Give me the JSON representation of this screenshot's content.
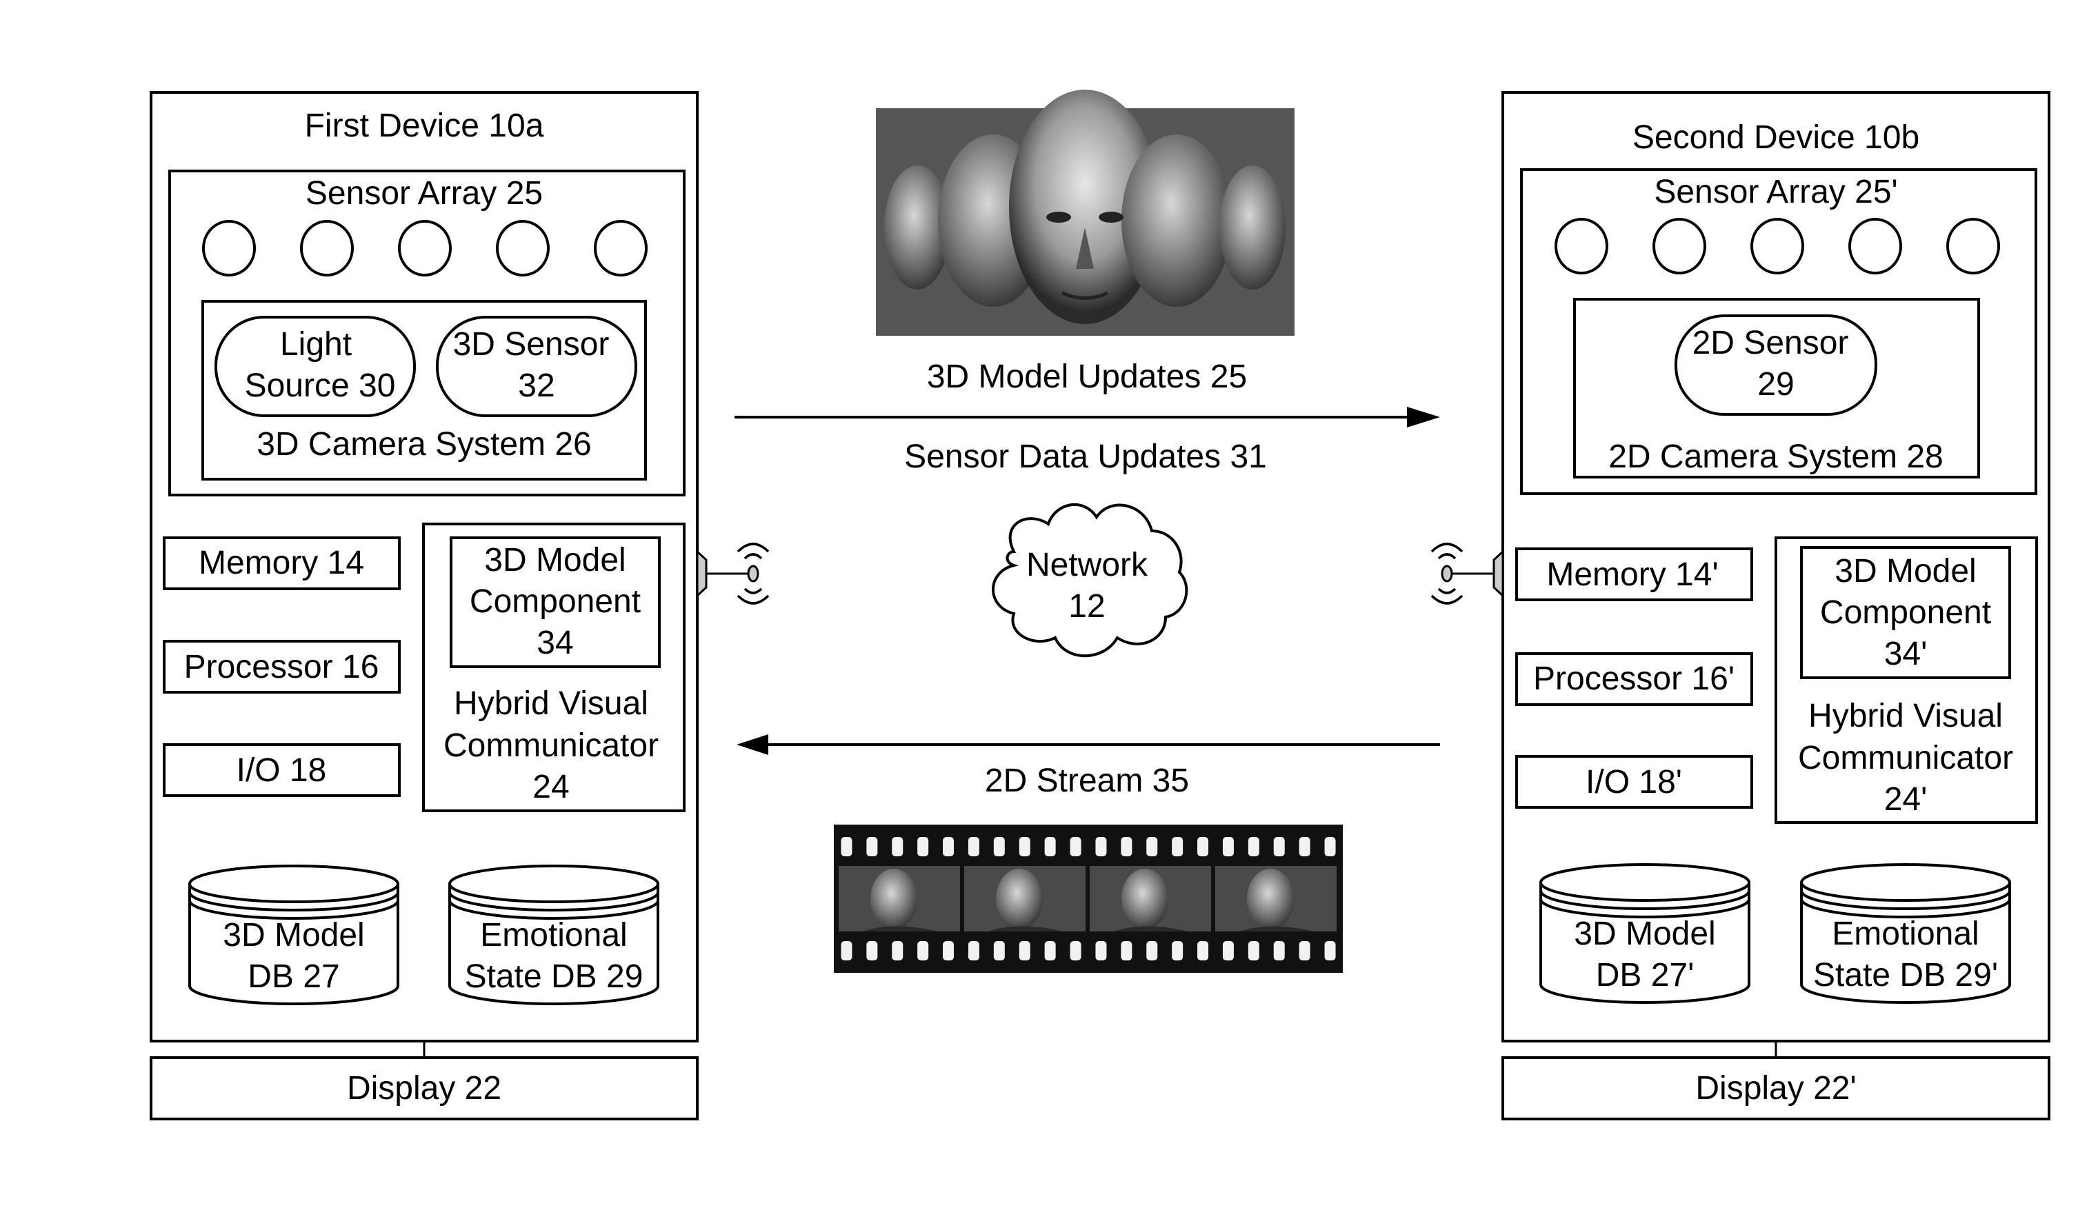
{
  "first_device": {
    "title": "First Device 10a",
    "sensor_array": "Sensor Array 25",
    "camera_system": "3D Camera System 26",
    "light_source": [
      "Light",
      "Source 30"
    ],
    "sensor": [
      "3D Sensor",
      "32"
    ],
    "memory": "Memory 14",
    "processor": "Processor 16",
    "io": "I/O 18",
    "model_component": [
      "3D Model",
      "Component",
      "34"
    ],
    "communicator": [
      "Hybrid Visual",
      "Communicator",
      "24"
    ],
    "model_db": [
      "3D Model",
      "DB 27"
    ],
    "emotional_db": [
      "Emotional",
      "State DB 29"
    ],
    "display": "Display 22"
  },
  "second_device": {
    "title": "Second Device 10b",
    "sensor_array": "Sensor Array 25'",
    "camera_system": "2D Camera System 28",
    "sensor": [
      "2D Sensor",
      "29"
    ],
    "memory": "Memory 14'",
    "processor": "Processor 16'",
    "io": "I/O 18'",
    "model_component": [
      "3D Model",
      "Component",
      "34'"
    ],
    "communicator": [
      "Hybrid Visual",
      "Communicator",
      "24'"
    ],
    "model_db": [
      "3D Model",
      "DB 27'"
    ],
    "emotional_db": [
      "Emotional",
      "State DB 29'"
    ],
    "display": "Display 22'"
  },
  "center": {
    "model_updates": "3D Model Updates 25",
    "sensor_updates": "Sensor Data Updates 31",
    "network": [
      "Network",
      "12"
    ],
    "stream": "2D Stream 35"
  },
  "film_strip": {
    "frames": 4,
    "sprockets_per_row": 20
  },
  "sensor_circles": 5
}
